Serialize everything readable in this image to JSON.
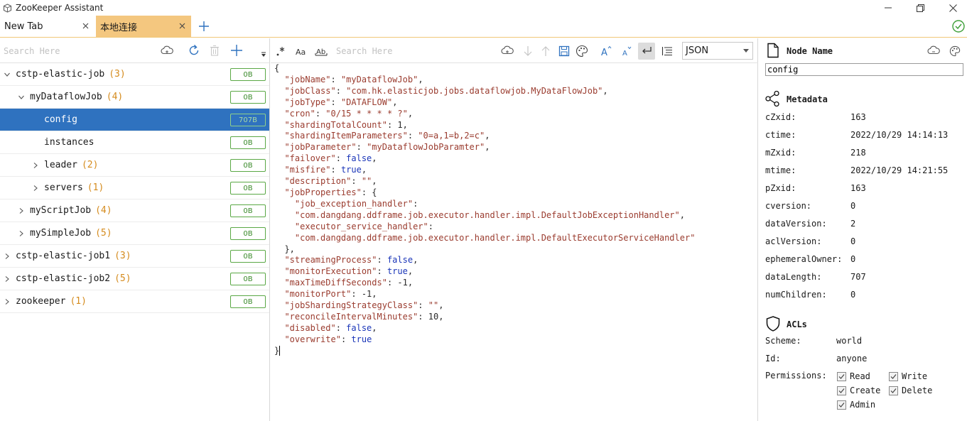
{
  "window": {
    "title": "ZooKeeper Assistant"
  },
  "tabs": [
    {
      "label": "New Tab"
    },
    {
      "label": "本地连接"
    }
  ],
  "tree_search": {
    "placeholder": "Search Here"
  },
  "editor_search": {
    "placeholder": "Search Here"
  },
  "format_select": {
    "value": "JSON"
  },
  "tree": [
    {
      "name": "cstp-elastic-job",
      "count": "(3)",
      "size": "0B"
    },
    {
      "name": "myDataflowJob",
      "count": "(4)",
      "size": "0B"
    },
    {
      "name": "config",
      "count": "",
      "size": "707B"
    },
    {
      "name": "instances",
      "count": "",
      "size": "0B"
    },
    {
      "name": "leader",
      "count": "(2)",
      "size": "0B"
    },
    {
      "name": "servers",
      "count": "(1)",
      "size": "0B"
    },
    {
      "name": "myScriptJob",
      "count": "(4)",
      "size": "0B"
    },
    {
      "name": "mySimpleJob",
      "count": "(5)",
      "size": "0B"
    },
    {
      "name": "cstp-elastic-job1",
      "count": "(3)",
      "size": "0B"
    },
    {
      "name": "cstp-elastic-job2",
      "count": "(5)",
      "size": "0B"
    },
    {
      "name": "zookeeper",
      "count": "(1)",
      "size": "0B"
    }
  ],
  "editor_lines": [
    "{",
    "  \"jobName\": \"myDataflowJob\",",
    "  \"jobClass\": \"com.hk.elasticjob.jobs.dataflowjob.MyDataFlowJob\",",
    "  \"jobType\": \"DATAFLOW\",",
    "  \"cron\": \"0/15 * * * * ?\",",
    "  \"shardingTotalCount\": 1,",
    "  \"shardingItemParameters\": \"0=a,1=b,2=c\",",
    "  \"jobParameter\": \"myDataflowJobParamter\",",
    "  \"failover\": false,",
    "  \"misfire\": true,",
    "  \"description\": \"\",",
    "  \"jobProperties\": {",
    "    \"job_exception_handler\":",
    "    \"com.dangdang.ddframe.job.executor.handler.impl.DefaultJobExceptionHandler\",",
    "    \"executor_service_handler\":",
    "    \"com.dangdang.ddframe.job.executor.handler.impl.DefaultExecutorServiceHandler\"",
    "  },",
    "  \"streamingProcess\": false,",
    "  \"monitorExecution\": true,",
    "  \"maxTimeDiffSeconds\": -1,",
    "  \"monitorPort\": -1,",
    "  \"jobShardingStrategyClass\": \"\",",
    "  \"reconcileIntervalMinutes\": 10,",
    "  \"disabled\": false,",
    "  \"overwrite\": true",
    "}"
  ],
  "node": {
    "title": "Node Name",
    "value": "config"
  },
  "metadata": {
    "title": "Metadata",
    "rows": [
      {
        "label": "cZxid:",
        "value": "163"
      },
      {
        "label": "ctime:",
        "value": "2022/10/29 14:14:13"
      },
      {
        "label": "mZxid:",
        "value": "218"
      },
      {
        "label": "mtime:",
        "value": "2022/10/29 14:21:55"
      },
      {
        "label": "pZxid:",
        "value": "163"
      },
      {
        "label": "cversion:",
        "value": "0"
      },
      {
        "label": "dataVersion:",
        "value": "2"
      },
      {
        "label": "aclVersion:",
        "value": "0"
      },
      {
        "label": "ephemeralOwner:",
        "value": "0"
      },
      {
        "label": "dataLength:",
        "value": "707"
      },
      {
        "label": "numChildren:",
        "value": "0"
      }
    ]
  },
  "acls": {
    "title": "ACLs",
    "scheme_label": "Scheme:",
    "scheme_value": "world",
    "id_label": "Id:",
    "id_value": "anyone",
    "permissions_label": "Permissions:",
    "permissions": [
      {
        "label": "Read",
        "checked": true
      },
      {
        "label": "Write",
        "checked": true
      },
      {
        "label": "Create",
        "checked": true
      },
      {
        "label": "Delete",
        "checked": true
      },
      {
        "label": "Admin",
        "checked": true
      }
    ]
  },
  "colors": {
    "accent_tab": "#f4c77f",
    "selection": "#2f72bf",
    "badge_border": "#5aa845",
    "count": "#d58b1d"
  }
}
